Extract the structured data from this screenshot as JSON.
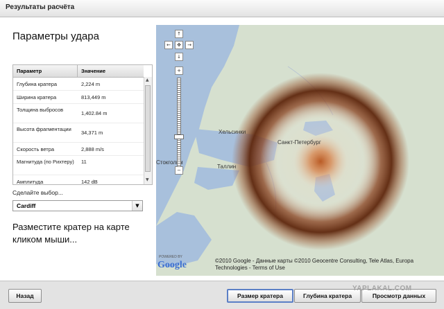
{
  "window": {
    "title": "Результаты расчёта"
  },
  "panel": {
    "title": "Параметры удара",
    "table": {
      "headers": [
        "Параметр",
        "Значение"
      ],
      "rows": [
        {
          "param": "Глубина кратера",
          "value": "2,224 m"
        },
        {
          "param": "Ширина кратера",
          "value": "813,449 m"
        },
        {
          "param": "Толщина выбросов",
          "value": "1,402.84 m"
        },
        {
          "param": "Высота фрагментации",
          "value": "34,371 m"
        },
        {
          "param": "Скорость ветра",
          "value": "2,888 m/s"
        },
        {
          "param": "Магнитуда (по Рихтеру)",
          "value": "11"
        },
        {
          "param": "Амплитуда",
          "value": "142 dB"
        }
      ]
    },
    "choose_label": "Сделайте выбор...",
    "select": {
      "value": "Cardiff"
    },
    "instruction": "Разместите кратер на карте кликом мыши..."
  },
  "map": {
    "labels": {
      "helsinki": "Хельсинки",
      "tallinn": "Таллин",
      "stpetersburg": "Санкт-Петербург",
      "stockholm": "Стокгольм"
    },
    "copyright": "©2010 Google - Данные карты ©2010 Geocentre Consulting, Tele Atlas, Europa Technologies - Terms of Use",
    "logo": "Google",
    "powered_by": "POWERED BY",
    "colors": {
      "water": "#a8c0dc",
      "land": "#d6e0cf",
      "crater_center": "#c2581e",
      "crater_ring": "#6b2e10"
    }
  },
  "footer": {
    "back": "Назад",
    "tabs": [
      "Размер кратера",
      "Глубина кратера",
      "Просмотр данных"
    ],
    "active_tab": "Размер кратера",
    "watermark": "YAPLAKAL.COM"
  }
}
